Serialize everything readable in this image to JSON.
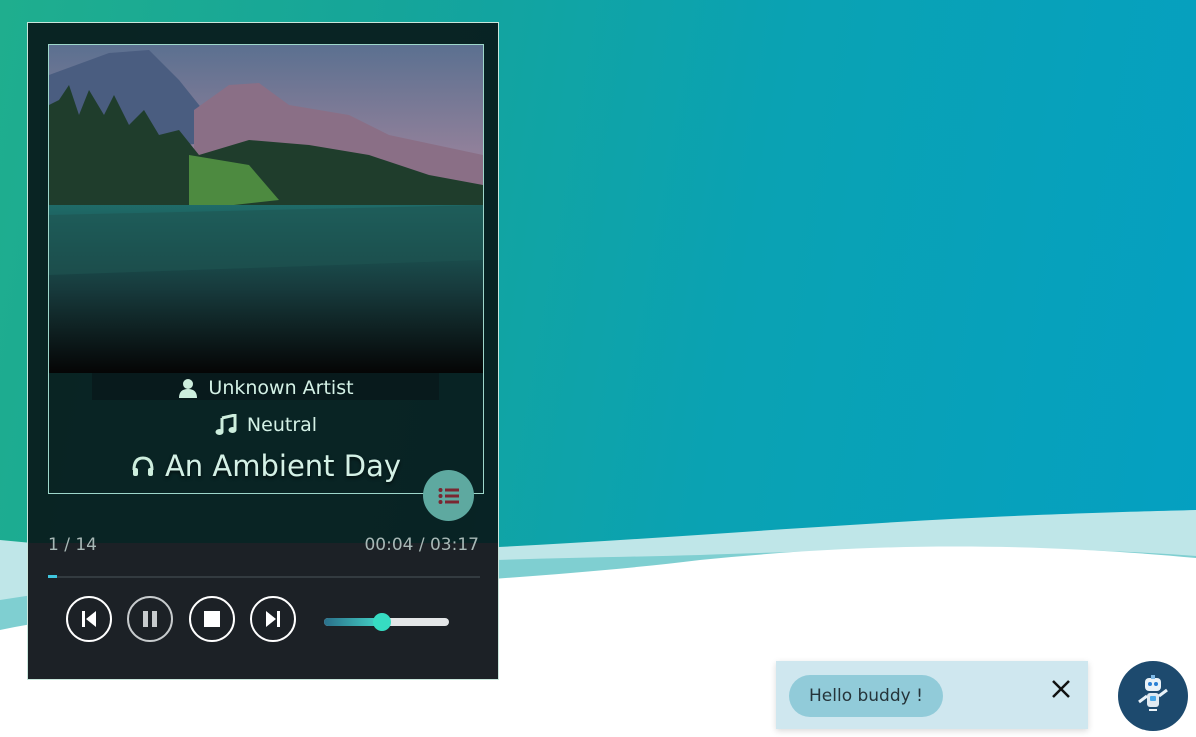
{
  "player": {
    "artist": "Unknown Artist",
    "mood": "Neutral",
    "title": "An Ambient Day",
    "track_counter": "1 / 14",
    "time": "00:04 / 03:17",
    "progress": 0.02,
    "volume": 0.46
  },
  "icons": {
    "artist": "user-icon",
    "mood": "music-note-icon",
    "title": "headphones-icon",
    "playlist": "list-icon",
    "prev": "skip-back-icon",
    "pause": "pause-icon",
    "stop": "stop-icon",
    "next": "skip-forward-icon",
    "close": "close-icon",
    "bot": "robot-icon"
  },
  "chat": {
    "greeting": "Hello buddy !"
  },
  "colors": {
    "accent": "#36dcc2",
    "text": "#d4f1e6",
    "player_bg": "#081c1e",
    "bot_bg": "#1d4a6e"
  }
}
